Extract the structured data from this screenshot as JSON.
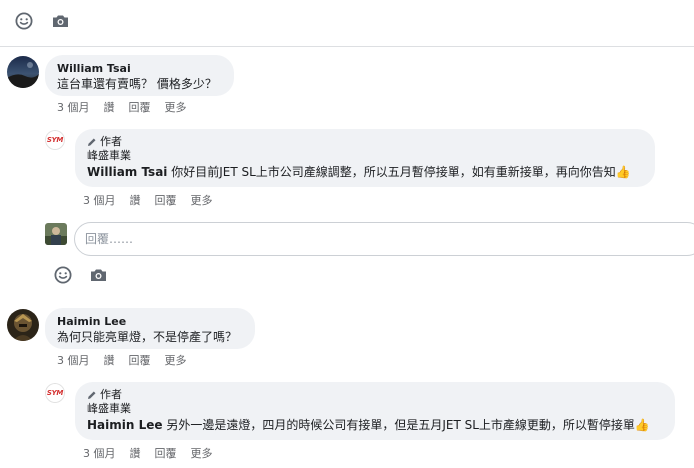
{
  "top_toolbar": {
    "emoji_icon": "emoji-icon",
    "camera_icon": "camera-icon"
  },
  "comments": [
    {
      "author": "William Tsai",
      "text": "這台車還有賣嗎？ 價格多少？",
      "actions": [
        "3 個月",
        "讚",
        "回覆",
        "更多"
      ],
      "reply": {
        "author_badge": "作者",
        "page_name": "峰盛車業",
        "mention": "William Tsai",
        "text": " 你好目前JET SL上市公司產線調整，所以五月暫停接單，如有重新接單，再向你告知",
        "actions": [
          "3 個月",
          "讚",
          "回覆",
          "更多"
        ],
        "logo_text": "SYM"
      }
    },
    {
      "author": "Haimin Lee",
      "text": "為何只能亮單燈，不是停產了嗎？",
      "actions": [
        "3 個月",
        "讚",
        "回覆",
        "更多"
      ],
      "reply": {
        "author_badge": "作者",
        "page_name": "峰盛車業",
        "mention": "Haimin Lee",
        "text": " 另外一邊是遠燈，四月的時候公司有接單，但是五月JET SL上市產線更動，所以暫停接單",
        "actions": [
          "3 個月",
          "讚",
          "回覆",
          "更多"
        ],
        "logo_text": "SYM"
      }
    }
  ],
  "reply_box": {
    "placeholder": "回覆……"
  },
  "colors": {
    "bubble": "#f0f2f5",
    "meta": "#65676b",
    "brand_red": "#d32f2f",
    "thumb": "#f5b400"
  }
}
